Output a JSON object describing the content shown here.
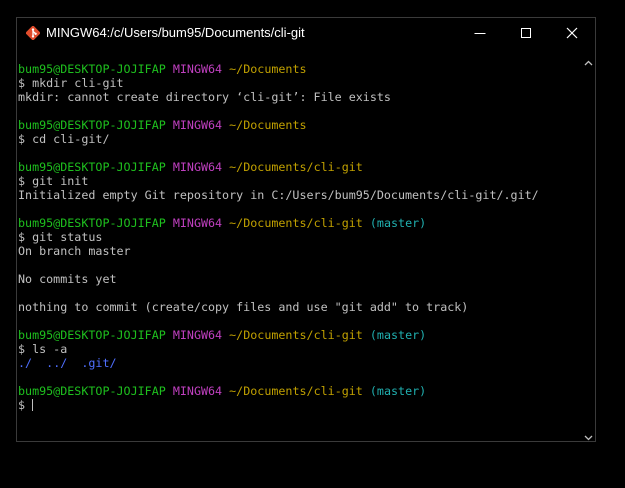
{
  "window": {
    "title": "MINGW64:/c/Users/bum95/Documents/cli-git"
  },
  "icons": {
    "app": "git-bash-icon",
    "minimize": "minimize-icon",
    "maximize": "maximize-icon",
    "close": "close-icon",
    "scroll_up": "chevron-up-icon",
    "scroll_down": "chevron-down-icon"
  },
  "colors": {
    "user": "#1ec01e",
    "system": "#c040c0",
    "path": "#c0a000",
    "branch": "#20b0b0",
    "directory": "#4f6fff",
    "text": "#c0c0c0",
    "background": "#000000"
  },
  "terminal": {
    "blocks": [
      {
        "prompt": {
          "user": "bum95@DESKTOP-JOJIFAP",
          "system": "MINGW64",
          "path": "~/Documents",
          "branch": ""
        },
        "command": "$ mkdir cli-git",
        "output": [
          "mkdir: cannot create directory ‘cli-git’: File exists"
        ]
      },
      {
        "prompt": {
          "user": "bum95@DESKTOP-JOJIFAP",
          "system": "MINGW64",
          "path": "~/Documents",
          "branch": ""
        },
        "command": "$ cd cli-git/",
        "output": []
      },
      {
        "prompt": {
          "user": "bum95@DESKTOP-JOJIFAP",
          "system": "MINGW64",
          "path": "~/Documents/cli-git",
          "branch": ""
        },
        "command": "$ git init",
        "output": [
          "Initialized empty Git repository in C:/Users/bum95/Documents/cli-git/.git/"
        ]
      },
      {
        "prompt": {
          "user": "bum95@DESKTOP-JOJIFAP",
          "system": "MINGW64",
          "path": "~/Documents/cli-git",
          "branch": "(master)"
        },
        "command": "$ git status",
        "output": [
          "On branch master",
          "",
          "No commits yet",
          "",
          "nothing to commit (create/copy files and use \"git add\" to track)"
        ]
      },
      {
        "prompt": {
          "user": "bum95@DESKTOP-JOJIFAP",
          "system": "MINGW64",
          "path": "~/Documents/cli-git",
          "branch": "(master)"
        },
        "command": "$ ls -a",
        "listing": [
          "./",
          "../",
          ".git/"
        ]
      },
      {
        "prompt": {
          "user": "bum95@DESKTOP-JOJIFAP",
          "system": "MINGW64",
          "path": "~/Documents/cli-git",
          "branch": "(master)"
        },
        "command": "$ "
      }
    ]
  }
}
